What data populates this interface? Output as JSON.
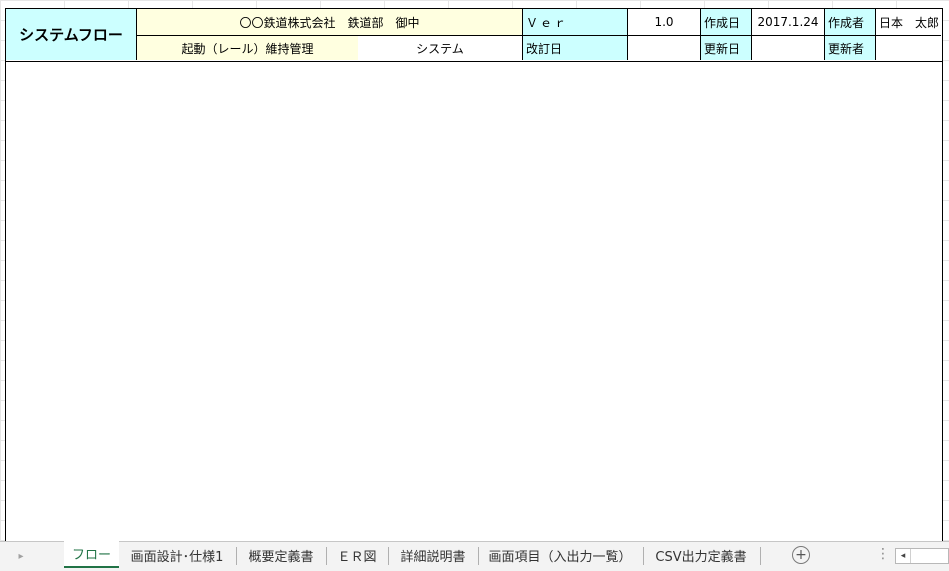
{
  "header": {
    "title": "システムフロー",
    "client": "〇〇鉄道株式会社　鉄道部　御中",
    "process": "起動（レール）維持管理",
    "system": "システム",
    "ver_label": "Ｖｅｒ",
    "ver_value": "1.0",
    "created_label": "作成日",
    "created_value": "2017.1.24",
    "author_label": "作成者",
    "author_value": "日本　太郎",
    "revised_label": "改訂日",
    "revised_value": "",
    "updated_label": "更新日",
    "updated_value": "",
    "updater_label": "更新者",
    "updater_value": ""
  },
  "tabs": [
    {
      "label": "フロー",
      "active": true
    },
    {
      "label": "画面設計･仕様1",
      "active": false
    },
    {
      "label": "概要定義書",
      "active": false
    },
    {
      "label": "ＥＲ図",
      "active": false
    },
    {
      "label": "詳細説明書",
      "active": false
    },
    {
      "label": "画面項目（入出力一覧）",
      "active": false
    },
    {
      "label": "CSV出力定義書",
      "active": false
    }
  ],
  "controls": {
    "add_sheet_icon": "plus-circle-icon",
    "more_icon": "vertical-dots-icon",
    "scroll_left_icon": "triangle-left-icon",
    "nav_right_icon": "triangle-right-icon"
  },
  "colors": {
    "label_cyan": "#ccffff",
    "label_cream": "#ffffe0",
    "active_tab": "#217346"
  }
}
